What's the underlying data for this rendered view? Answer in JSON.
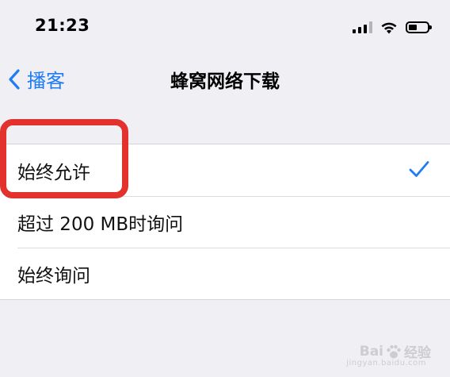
{
  "status_bar": {
    "time": "21:23"
  },
  "nav": {
    "back_label": "播客",
    "title": "蜂窝网络下载"
  },
  "options": [
    {
      "label": "始终允许",
      "selected": true
    },
    {
      "label": "超过 200 MB时询问",
      "selected": false
    },
    {
      "label": "始终询问",
      "selected": false
    }
  ],
  "watermark": {
    "brand_left": "Bai",
    "brand_right": "经验",
    "url": "jingyan.baidu.com"
  },
  "colors": {
    "accent": "#1f7cf5",
    "highlight": "#e3322e",
    "background": "#efeff4"
  }
}
